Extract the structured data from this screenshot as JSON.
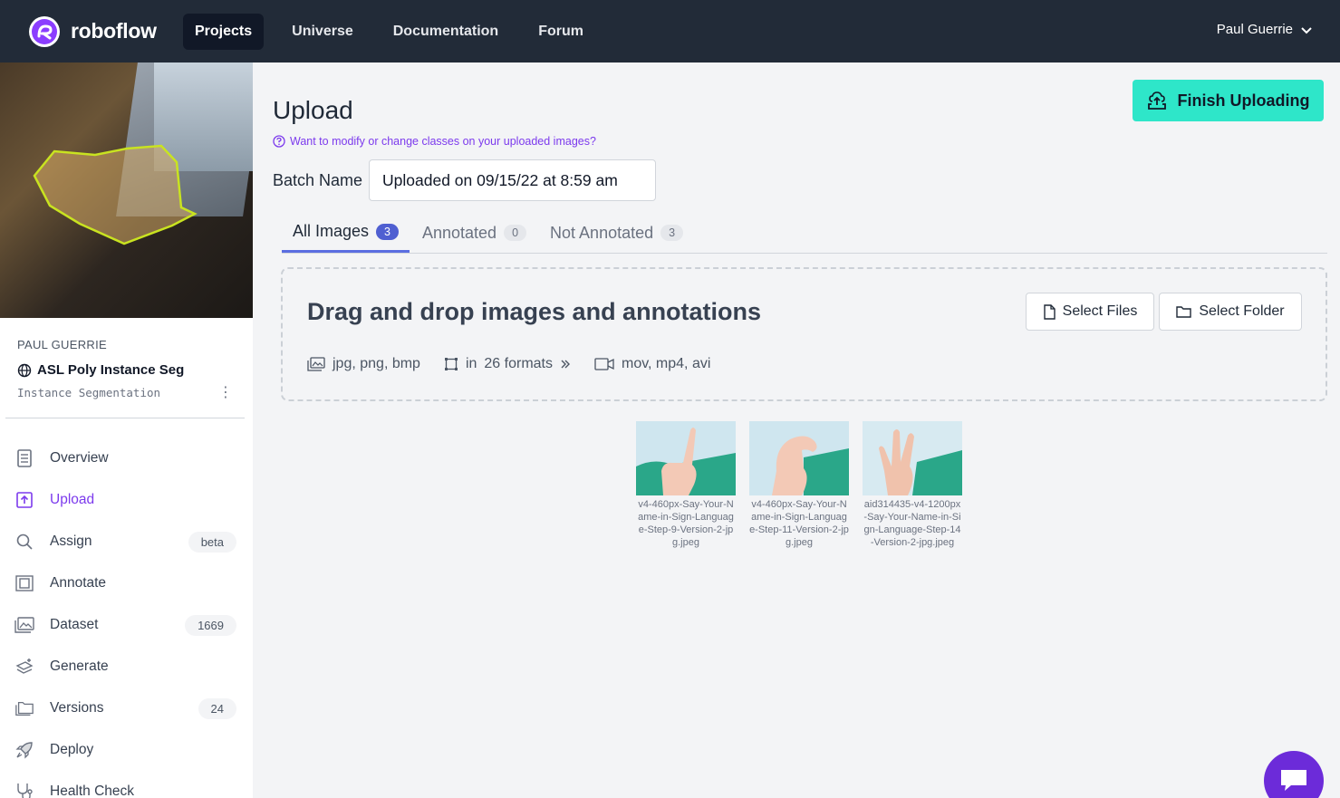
{
  "brand": {
    "name": "roboflow"
  },
  "nav": {
    "items": [
      {
        "label": "Projects",
        "active": true
      },
      {
        "label": "Universe"
      },
      {
        "label": "Documentation"
      },
      {
        "label": "Forum"
      }
    ],
    "user": "Paul Guerrie"
  },
  "sidebar": {
    "owner": "PAUL GUERRIE",
    "project_name": "ASL Poly Instance Seg",
    "project_type": "Instance Segmentation",
    "menu": [
      {
        "label": "Overview",
        "icon": "document-icon"
      },
      {
        "label": "Upload",
        "icon": "upload-icon",
        "active": true
      },
      {
        "label": "Assign",
        "icon": "search-icon",
        "badge": "beta"
      },
      {
        "label": "Annotate",
        "icon": "annotate-icon"
      },
      {
        "label": "Dataset",
        "icon": "images-icon",
        "badge": "1669"
      },
      {
        "label": "Generate",
        "icon": "generate-icon"
      },
      {
        "label": "Versions",
        "icon": "folders-icon",
        "badge": "24"
      },
      {
        "label": "Deploy",
        "icon": "rocket-icon"
      },
      {
        "label": "Health Check",
        "icon": "stethoscope-icon"
      }
    ]
  },
  "main": {
    "title": "Upload",
    "help_link": "Want to modify or change classes on your uploaded images?",
    "finish_button": "Finish Uploading",
    "batch_label": "Batch Name",
    "batch_value": "Uploaded on 09/15/22 at 8:59 am",
    "tabs": [
      {
        "label": "All Images",
        "count": "3",
        "active": true
      },
      {
        "label": "Annotated",
        "count": "0"
      },
      {
        "label": "Not Annotated",
        "count": "3"
      }
    ],
    "dropzone": {
      "title": "Drag and drop images and annotations",
      "image_formats": "jpg, png, bmp",
      "annotation_formats_prefix": "in",
      "annotation_formats_count": "26 formats",
      "video_formats": "mov, mp4, avi",
      "select_files": "Select Files",
      "select_folder": "Select Folder"
    },
    "thumbnails": [
      {
        "name": "v4-460px-Say-Your-Name-in-Sign-Language-Step-9-Version-2-jpg.jpeg"
      },
      {
        "name": "v4-460px-Say-Your-Name-in-Sign-Language-Step-11-Version-2-jpg.jpeg"
      },
      {
        "name": "aid314435-v4-1200px-Say-Your-Name-in-Sign-Language-Step-14-Version-2-jpg.jpeg"
      }
    ]
  },
  "colors": {
    "nav_bg": "#222b38",
    "accent": "#2ee6c9",
    "purple": "#7c3aed",
    "tab_indicator": "#5b6ee1"
  }
}
